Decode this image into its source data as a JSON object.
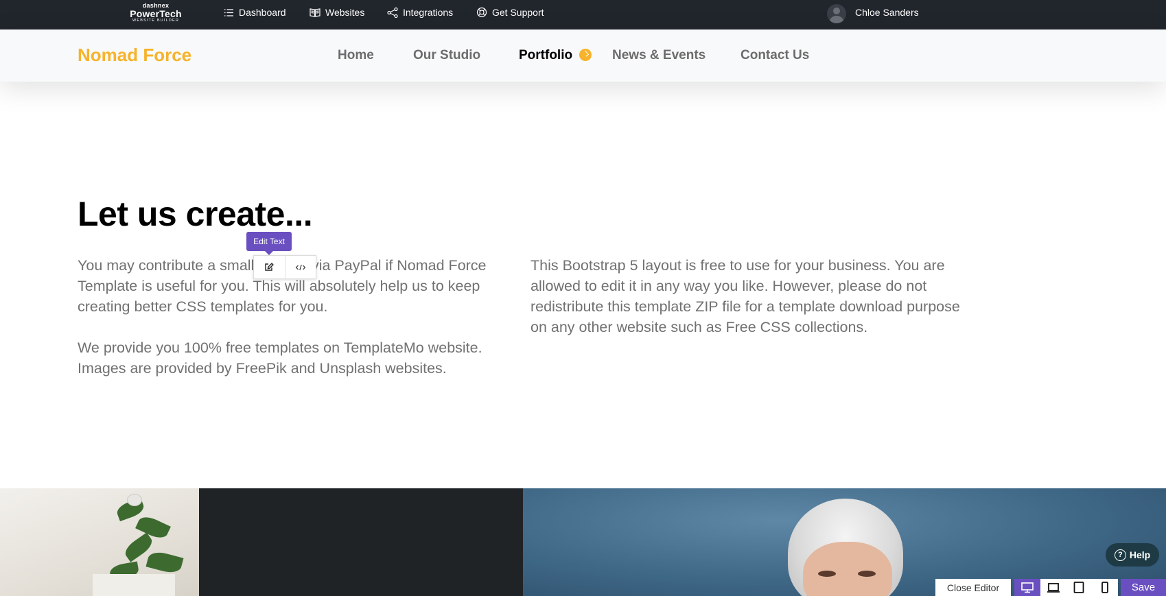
{
  "adminbar": {
    "brand_top": "dashnex",
    "brand_main": "PowerTech",
    "brand_sub": "WEBSITE BUILDER",
    "nav": [
      {
        "label": "Dashboard",
        "icon": "list-icon"
      },
      {
        "label": "Websites",
        "icon": "book-icon"
      },
      {
        "label": "Integrations",
        "icon": "share-icon"
      },
      {
        "label": "Get Support",
        "icon": "lifebuoy-icon"
      }
    ],
    "user_name": "Chloe Sanders"
  },
  "site": {
    "logo": "Nomad Force",
    "menu": [
      {
        "label": "Home",
        "active": false
      },
      {
        "label": "Our Studio",
        "active": false
      },
      {
        "label": "Portfolio",
        "active": true
      },
      {
        "label": "News & Events",
        "active": false
      },
      {
        "label": "Contact Us",
        "active": false
      }
    ],
    "accent_color": "#f6b32b"
  },
  "content": {
    "heading": "Let us create...",
    "left_para_1": "You may contribute a small amount via PayPal if Nomad Force Template is useful for you. This will absolutely help us to keep creating better CSS templates for you.",
    "left_para_2": "We provide you 100% free templates on TemplateMo website. Images are provided by FreePik and Unsplash websites.",
    "right_para": "This Bootstrap 5 layout is free to use for your business. You are allowed to edit it in any way you like. However, please do not redistribute this template ZIP file for a template download purpose on any other website such as Free CSS collections."
  },
  "editor": {
    "tooltip": "Edit Text",
    "edit_icon": "edit-icon",
    "code_icon": "code-icon",
    "help_label": "Help",
    "close_label": "Close Editor",
    "save_label": "Save",
    "devices": [
      "desktop-icon",
      "laptop-icon",
      "tablet-icon",
      "mobile-icon"
    ],
    "accent_color": "#6a4fc1"
  }
}
